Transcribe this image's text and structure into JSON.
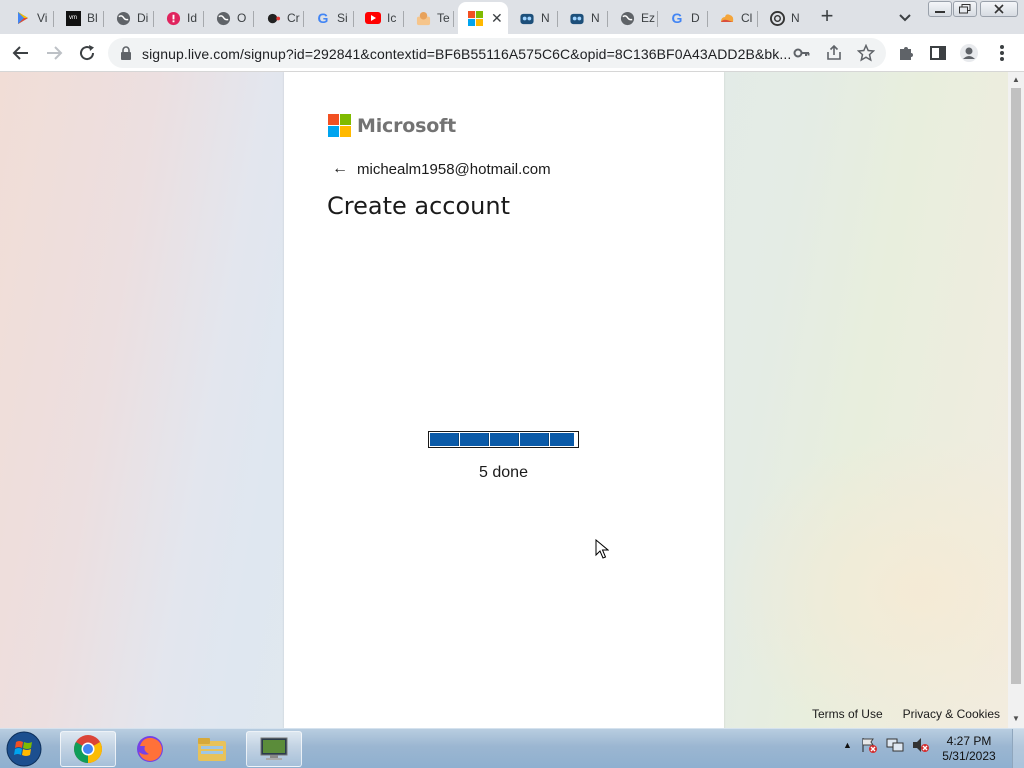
{
  "browser": {
    "tabs": [
      {
        "label": "Vi",
        "icon": "play-store-icon"
      },
      {
        "label": "Bl",
        "icon": "vm-icon"
      },
      {
        "label": "Di",
        "icon": "globe-icon"
      },
      {
        "label": "Id",
        "icon": "red-circle-icon"
      },
      {
        "label": "O",
        "icon": "globe-icon"
      },
      {
        "label": "Cr",
        "icon": "dots-icon"
      },
      {
        "label": "Si",
        "icon": "google-icon"
      },
      {
        "label": "Ic",
        "icon": "youtube-icon"
      },
      {
        "label": "Te",
        "icon": "person-icon"
      },
      {
        "label": "",
        "icon": "microsoft-icon",
        "active": true
      },
      {
        "label": "N",
        "icon": "robot-icon"
      },
      {
        "label": "N",
        "icon": "robot-icon"
      },
      {
        "label": "Ez",
        "icon": "globe-icon"
      },
      {
        "label": "D",
        "icon": "google-icon"
      },
      {
        "label": "Cl",
        "icon": "cloud-icon"
      },
      {
        "label": "N",
        "icon": "chatgpt-icon"
      }
    ],
    "active_tab_close": "✕",
    "new_tab": "+",
    "url": "signup.live.com/signup?id=292841&contextid=BF6B55116A575C6C&opid=8C136BF0A43ADD2B&bk..."
  },
  "page": {
    "brand": "Microsoft",
    "identity_email": "michealm1958@hotmail.com",
    "heading": "Create account",
    "progress": {
      "completed_segments": 5,
      "fraction": 0.97,
      "label": "5 done"
    },
    "footer": {
      "terms": "Terms of Use",
      "privacy": "Privacy & Cookies"
    }
  },
  "taskbar": {
    "apps": [
      "chrome-icon",
      "firefox-icon",
      "file-explorer-icon",
      "remote-desktop-icon"
    ],
    "clock_time": "4:27 PM",
    "clock_date": "5/31/2023"
  },
  "colors": {
    "progress_fill": "#0a5aa8",
    "ms_red": "#f25022",
    "ms_green": "#7fba00",
    "ms_blue": "#00a4ef",
    "ms_yellow": "#ffb900"
  }
}
